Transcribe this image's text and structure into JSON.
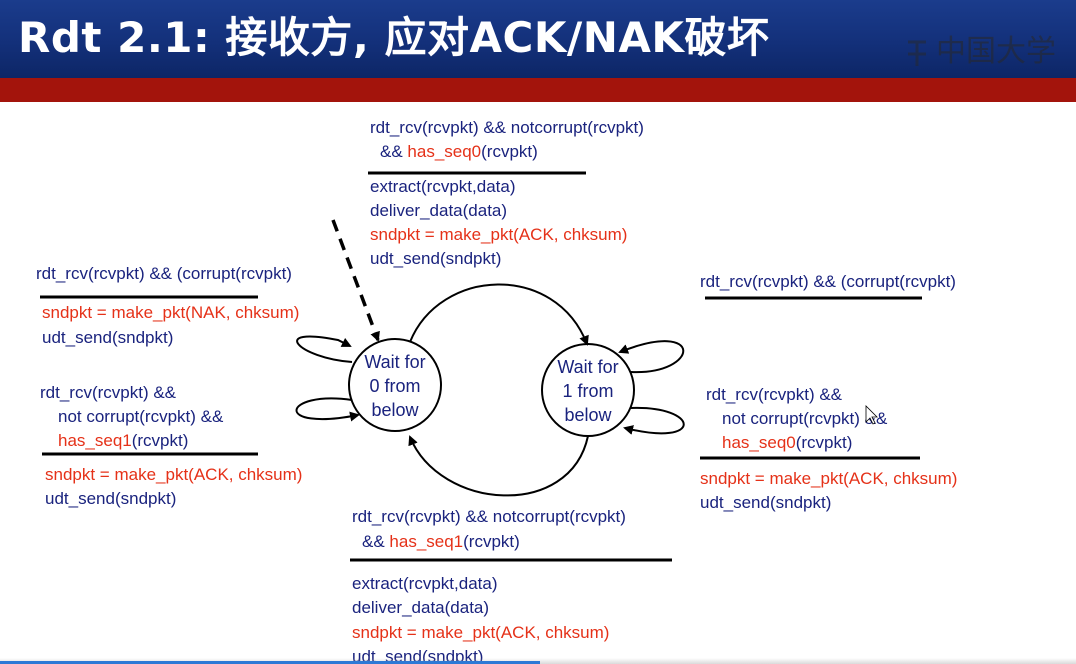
{
  "slide": {
    "title": "Rdt 2.1: 接收方, 应对ACK/NAK破坏",
    "watermark": "中国大学"
  },
  "diagram": {
    "states": [
      {
        "id": "wait0",
        "label_lines": [
          "Wait for",
          "0 from",
          "below"
        ]
      },
      {
        "id": "wait1",
        "label_lines": [
          "Wait for",
          "1 from",
          "below"
        ]
      }
    ],
    "transitions": {
      "top": {
        "event_line1": "rdt_rcv(rcvpkt) && notcorrupt(rcvpkt)",
        "event_line2_prefix": "&& ",
        "event_line2_red": "has_seq0",
        "event_line2_suffix": "(rcvpkt)",
        "actions": [
          {
            "text": "extract(rcvpkt,data)",
            "color": "blue"
          },
          {
            "text": "deliver_data(data)",
            "color": "blue"
          },
          {
            "text": "sndpkt = make_pkt(ACK, chksum)",
            "color": "red"
          },
          {
            "text": "udt_send(sndpkt)",
            "color": "blue"
          }
        ]
      },
      "left_upper": {
        "event": "rdt_rcv(rcvpkt) && (corrupt(rcvpkt)",
        "actions": [
          {
            "text": "sndpkt = make_pkt(NAK, chksum)",
            "color": "red"
          },
          {
            "text": "udt_send(sndpkt)",
            "color": "blue"
          }
        ]
      },
      "left_lower": {
        "event_line1": "rdt_rcv(rcvpkt) &&",
        "event_line2": "not corrupt(rcvpkt) &&",
        "event_line3_red": "has_seq1",
        "event_line3_suffix": "(rcvpkt)",
        "actions": [
          {
            "text": "sndpkt = make_pkt(ACK, chksum)",
            "color": "red"
          },
          {
            "text": "udt_send(sndpkt)",
            "color": "blue"
          }
        ]
      },
      "right_upper": {
        "event": "rdt_rcv(rcvpkt) && (corrupt(rcvpkt)"
      },
      "right_lower": {
        "event_line1": "rdt_rcv(rcvpkt) &&",
        "event_line2": "not corrupt(rcvpkt) &&",
        "event_line3_red": "has_seq0",
        "event_line3_suffix": "(rcvpkt)",
        "actions": [
          {
            "text": "sndpkt = make_pkt(ACK, chksum)",
            "color": "red"
          },
          {
            "text": "udt_send(sndpkt)",
            "color": "blue"
          }
        ]
      },
      "bottom": {
        "event_line1": "rdt_rcv(rcvpkt) && notcorrupt(rcvpkt)",
        "event_line2_prefix": "&& ",
        "event_line2_red": "has_seq1",
        "event_line2_suffix": "(rcvpkt)",
        "actions": [
          {
            "text": "extract(rcvpkt,data)",
            "color": "blue"
          },
          {
            "text": "deliver_data(data)",
            "color": "blue"
          },
          {
            "text": "sndpkt = make_pkt(ACK, chksum)",
            "color": "red"
          },
          {
            "text": "udt_send(sndpkt)",
            "color": "blue"
          }
        ]
      }
    }
  },
  "colors": {
    "title_bg": "#13307a",
    "band": "#a3140c",
    "text_blue": "#1a237e",
    "text_red": "#e53118"
  }
}
